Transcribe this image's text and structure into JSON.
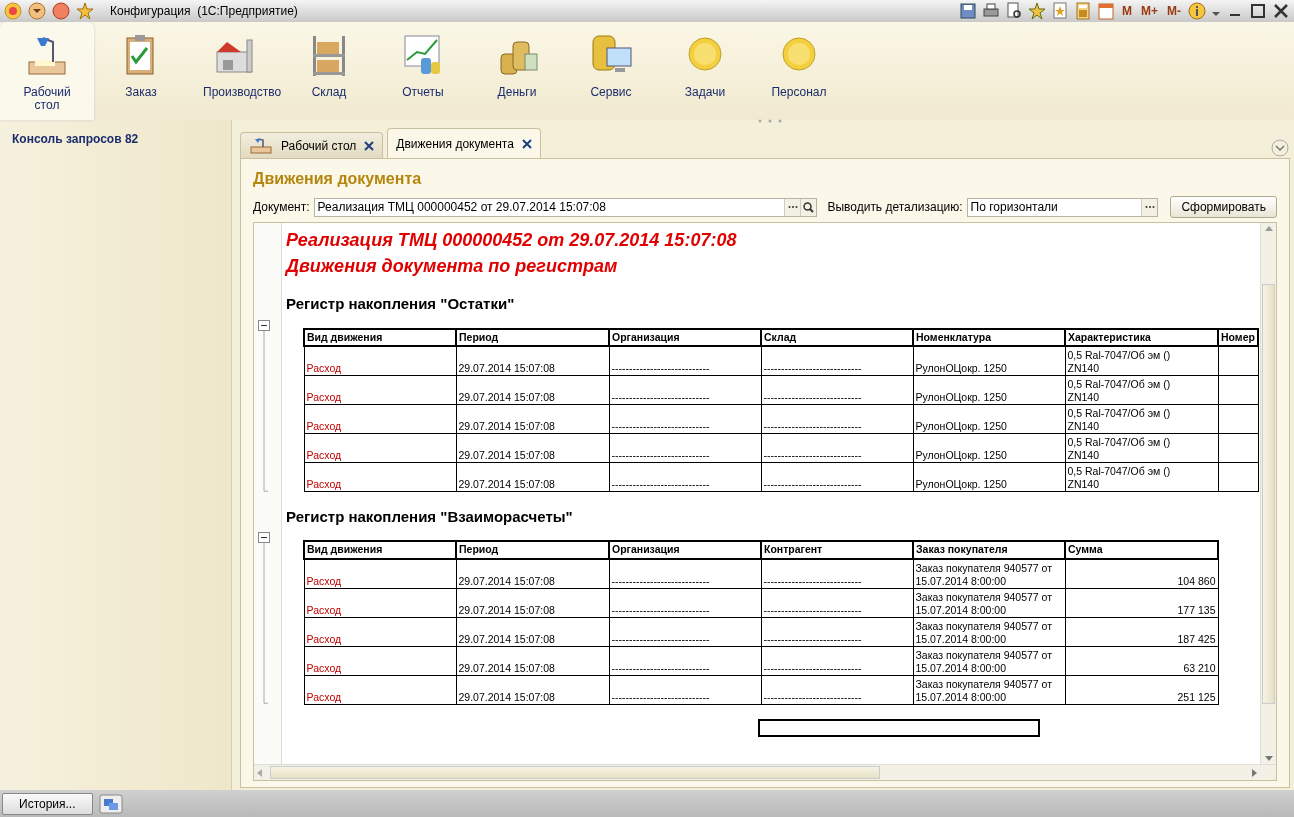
{
  "window": {
    "title": "Конфигурация  (1С:Предприятие)"
  },
  "toolbar": {
    "memory_buttons": [
      "M",
      "M+",
      "M-"
    ]
  },
  "sections": [
    {
      "label": "Рабочий стол",
      "selected": true
    },
    {
      "label": "Заказ",
      "selected": false
    },
    {
      "label": "Производство",
      "selected": false
    },
    {
      "label": "Склад",
      "selected": false
    },
    {
      "label": "Отчеты",
      "selected": false
    },
    {
      "label": "Деньги",
      "selected": false
    },
    {
      "label": "Сервис",
      "selected": false
    },
    {
      "label": "Задачи",
      "selected": false
    },
    {
      "label": "Персонал",
      "selected": false
    }
  ],
  "left_panel": {
    "items": [
      "Консоль запросов 82"
    ]
  },
  "tabs": [
    {
      "label": "Рабочий стол",
      "selected": false
    },
    {
      "label": "Движения документа",
      "selected": true
    }
  ],
  "form": {
    "title": "Движения документа",
    "document_label": "Документ:",
    "document_value": "Реализация ТМЦ 000000452 от 29.07.2014 15:07:08",
    "detail_label": "Выводить детализацию:",
    "detail_value": "По горизонтали",
    "submit_button": "Сформировать"
  },
  "report": {
    "title_lines": [
      "Реализация ТМЦ 000000452 от 29.07.2014 15:07:08",
      "Движения документа по регистрам"
    ],
    "registers": [
      {
        "title": "Регистр накопления \"Остатки\"",
        "expanded": true,
        "columns": [
          "Вид движения",
          "Период",
          "Организация",
          "Склад",
          "Номенклатура",
          "Характеристика",
          "Номер"
        ],
        "rows": [
          [
            "Расход",
            "29.07.2014 15:07:08",
            "----------------------------",
            "----------------------------",
            "РулонОЦокр. 1250",
            "0,5  Ral-7047/Об эм  ()\nZN140"
          ],
          [
            "Расход",
            "29.07.2014 15:07:08",
            "----------------------------",
            "----------------------------",
            "РулонОЦокр. 1250",
            "0,5  Ral-7047/Об эм  ()\nZN140"
          ],
          [
            "Расход",
            "29.07.2014 15:07:08",
            "----------------------------",
            "----------------------------",
            "РулонОЦокр. 1250",
            "0,5  Ral-7047/Об эм  ()\nZN140"
          ],
          [
            "Расход",
            "29.07.2014 15:07:08",
            "----------------------------",
            "----------------------------",
            "РулонОЦокр. 1250",
            "0,5  Ral-7047/Об эм  ()\nZN140"
          ],
          [
            "Расход",
            "29.07.2014 15:07:08",
            "----------------------------",
            "----------------------------",
            "РулонОЦокр. 1250",
            "0,5  Ral-7047/Об эм  ()\nZN140"
          ]
        ]
      },
      {
        "title": "Регистр накопления \"Взаиморасчеты\"",
        "expanded": true,
        "columns": [
          "Вид движения",
          "Период",
          "Организация",
          "Контрагент",
          "Заказ покупателя",
          "Сумма"
        ],
        "rows": [
          [
            "Расход",
            "29.07.2014 15:07:08",
            "----------------------------",
            "----------------------------",
            "Заказ покупателя 940577 от\n15.07.2014 8:00:00",
            "104 860"
          ],
          [
            "Расход",
            "29.07.2014 15:07:08",
            "----------------------------",
            "----------------------------",
            "Заказ покупателя 940577 от\n15.07.2014 8:00:00",
            "177 135"
          ],
          [
            "Расход",
            "29.07.2014 15:07:08",
            "----------------------------",
            "----------------------------",
            "Заказ покупателя 940577 от\n15.07.2014 8:00:00",
            "187 425"
          ],
          [
            "Расход",
            "29.07.2014 15:07:08",
            "----------------------------",
            "----------------------------",
            "Заказ покупателя 940577 от\n15.07.2014 8:00:00",
            "63 210"
          ],
          [
            "Расход",
            "29.07.2014 15:07:08",
            "----------------------------",
            "----------------------------",
            "Заказ покупателя 940577 от\n15.07.2014 8:00:00",
            "251 125"
          ]
        ]
      }
    ]
  },
  "status_bar": {
    "history_button": "История..."
  }
}
